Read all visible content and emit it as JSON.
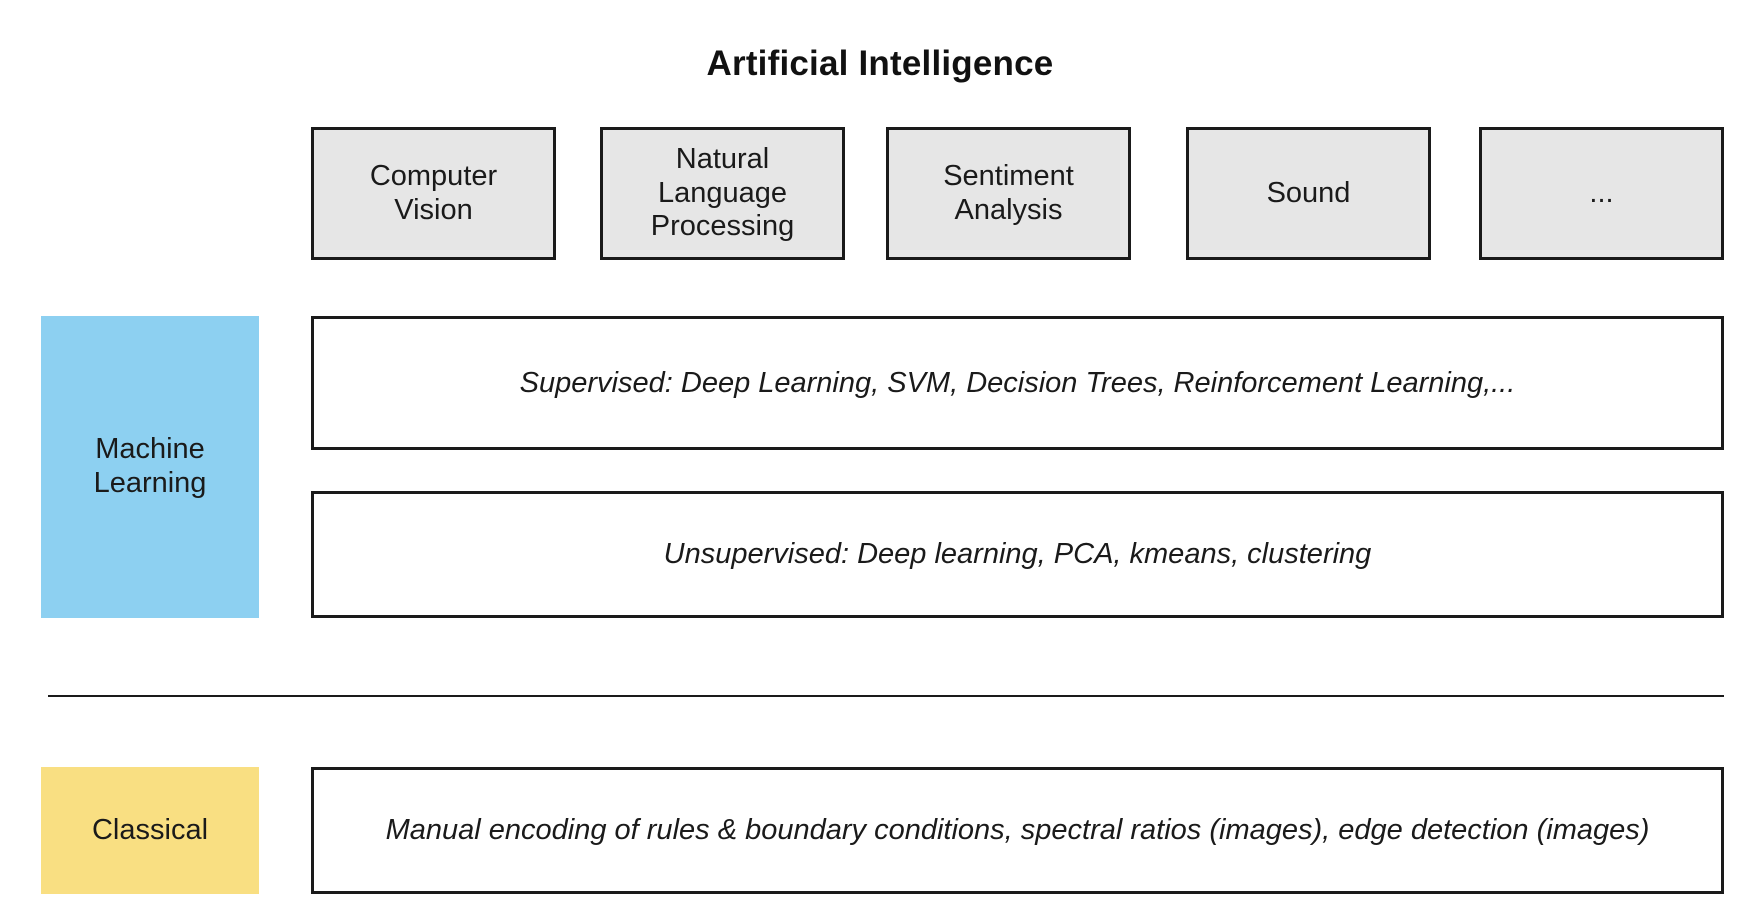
{
  "title": "Artificial Intelligence",
  "domains": [
    {
      "label": "Computer\nVision"
    },
    {
      "label": "Natural\nLanguage\nProcessing"
    },
    {
      "label": "Sentiment\nAnalysis"
    },
    {
      "label": "Sound"
    },
    {
      "label": "..."
    }
  ],
  "machine_learning": {
    "label": "Machine\nLearning",
    "supervised": "Supervised: Deep Learning, SVM, Decision Trees, Reinforcement Learning,...",
    "unsupervised": "Unsupervised: Deep learning, PCA, kmeans, clustering"
  },
  "classical": {
    "label": "Classical",
    "description": "Manual encoding of rules & boundary conditions, spectral ratios (images), edge detection (images)"
  },
  "colors": {
    "machine_learning_fill": "#8dd0f1",
    "classical_fill": "#f9df82",
    "domain_fill": "#e6e6e6",
    "border": "#1a1a1a"
  }
}
